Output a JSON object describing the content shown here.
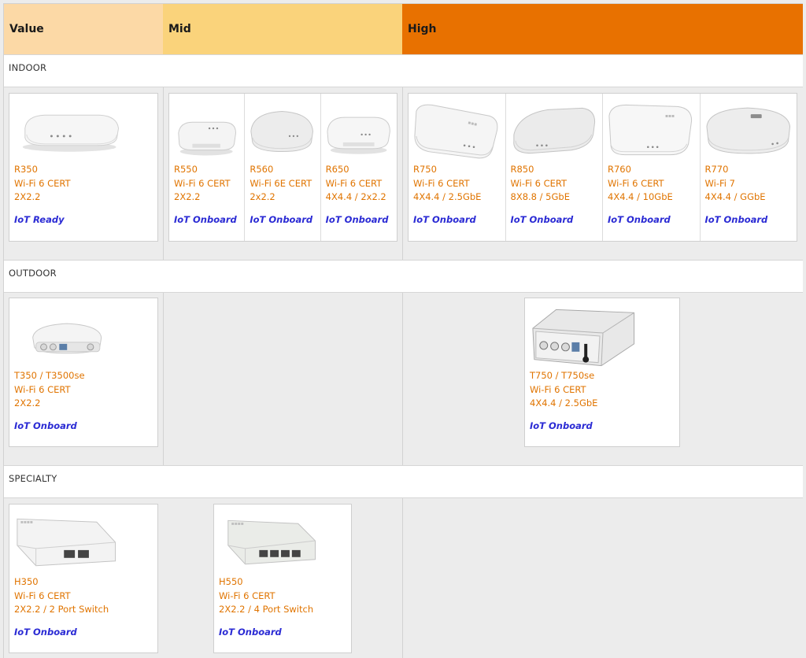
{
  "tiers": {
    "value": "Value",
    "mid": "Mid",
    "high": "High"
  },
  "sections": {
    "indoor": "INDOOR",
    "outdoor": "OUTDOOR",
    "specialty": "SPECIALTY"
  },
  "indoor": {
    "r350": {
      "model": "R350",
      "standard": "Wi-Fi 6 CERT",
      "spec": "2X2.2",
      "iot": "IoT Ready"
    },
    "r550": {
      "model": "R550",
      "standard": "Wi-Fi 6 CERT",
      "spec": "2X2.2",
      "iot": "IoT Onboard"
    },
    "r560": {
      "model": "R560",
      "standard": "Wi-Fi 6E CERT",
      "spec": "2x2.2",
      "iot": "IoT Onboard"
    },
    "r650": {
      "model": "R650",
      "standard": "Wi-Fi 6 CERT",
      "spec": "4X4.4 / 2x2.2",
      "iot": "IoT Onboard"
    },
    "r750": {
      "model": "R750",
      "standard": "Wi-Fi 6 CERT",
      "spec": "4X4.4 / 2.5GbE",
      "iot": "IoT Onboard"
    },
    "r850": {
      "model": "R850",
      "standard": "Wi-Fi 6 CERT",
      "spec": "8X8.8 / 5GbE",
      "iot": "IoT Onboard"
    },
    "r760": {
      "model": "R760",
      "standard": "Wi-Fi 6 CERT",
      "spec": "4X4.4 / 10GbE",
      "iot": "IoT Onboard"
    },
    "r770": {
      "model": "R770",
      "standard": "Wi-Fi 7",
      "spec": "4X4.4 / GGbE",
      "iot": "IoT Onboard"
    }
  },
  "outdoor": {
    "t350": {
      "model": "T350 / T3500se",
      "standard": "Wi-Fi 6 CERT",
      "spec": "2X2.2",
      "iot": "IoT Onboard"
    },
    "t750": {
      "model": "T750 / T750se",
      "standard": "Wi-Fi 6 CERT",
      "spec": "4X4.4 / 2.5GbE",
      "iot": "IoT Onboard"
    }
  },
  "specialty": {
    "h350": {
      "model": "H350",
      "standard": "Wi-Fi 6 CERT",
      "spec": "2X2.2 / 2 Port Switch",
      "iot": "IoT Onboard"
    },
    "h550": {
      "model": "H550",
      "standard": "Wi-Fi 6 CERT",
      "spec": "2X2.2 / 4 Port Switch",
      "iot": "IoT Onboard"
    }
  }
}
